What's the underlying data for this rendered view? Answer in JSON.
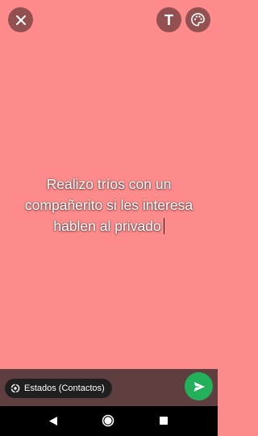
{
  "toolbar": {
    "close_icon": "close-icon",
    "text_tool_label": "T",
    "palette_icon": "palette-icon"
  },
  "status": {
    "lines": [
      "Realizo tríos con un",
      "compañerito si les interesa",
      "hablen al privado"
    ],
    "background_color": "#fd8b8b",
    "text_color": "#ffffff"
  },
  "audience": {
    "label": "Estados (Contactos)",
    "icon": "status-ring-icon"
  },
  "send": {
    "icon": "send-arrow-icon",
    "color": "#22b05a"
  },
  "navigation": {
    "back_icon": "back-triangle-icon",
    "home_icon": "home-circle-icon",
    "recents_icon": "recents-square-icon"
  }
}
